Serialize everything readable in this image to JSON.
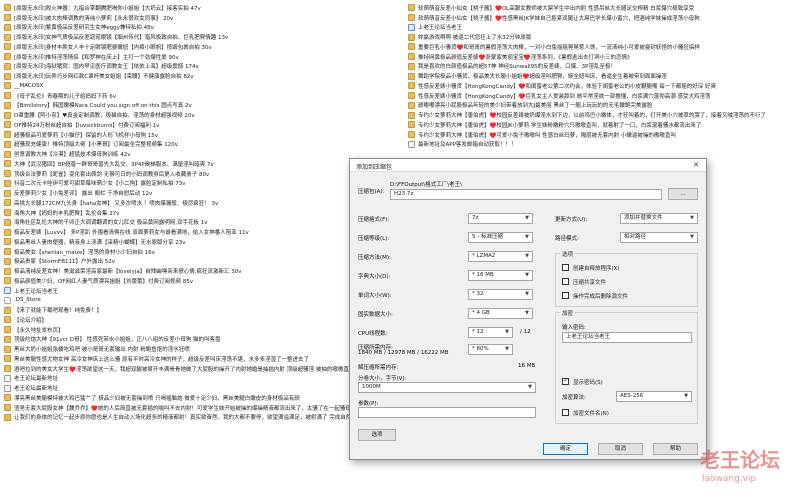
{
  "left_column": [
    {
      "icon": "folder",
      "name": "[原版无水印]败火神器：九指合掌翻腾肥喝你小姐姐【大奶云】接客实拍 47v"
    },
    {
      "icon": "folder",
      "name": "[原版无水印]被大肉棒调教的清纯小萝莉【永永很欢女同事】 20v"
    },
    {
      "icon": "folder",
      "name": "[原版无水印]紫黄极品反差研究生女神eggy兼特私拍 48v"
    },
    {
      "icon": "folder",
      "name": "[原版无水印]女神气质极品反差窈窕眼镜【烟州传代】猎风极致自拍、巨乳肥臀情趣 13v"
    },
    {
      "icon": "folder",
      "name": "[原版无水印]身材丰腴女人丰十足眼镜肥婆嫩妞【内裤小眼帆】揽毁包裹自拍 30v"
    },
    {
      "icon": "folder",
      "name": "[原版无水印]推特淫荡情侣【和罗神在床上】主打一个劲爆性爱 90v"
    },
    {
      "icon": "folder",
      "name": "[原版无水印]海狱猪窝：国内早见医疗调教女王【依依上海】超级震撼 174v"
    },
    {
      "icon": "folder",
      "name": "[原版无水印]玩弄巧步网红款C罩杯美女姐姐【束腰】不健康露脸自拍 82v"
    },
    {
      "icon": "folder",
      "name": "__MACOSX"
    },
    {
      "icon": "folder",
      "name": "《母子乱伦》青春期的儿子给妈妈下药 6v"
    },
    {
      "icon": "folder",
      "name": "【Bimilstory】韩国嫩模Nara Could you sign off on this 圆点写真 2v"
    },
    {
      "icon": "folder",
      "name": "D罩重腰【阿小奈】♥真金定制调教，极猫自拍、淫荡的身材超强视频 20v"
    },
    {
      "icon": "folder",
      "name": "OF推特24万粉丝超自拍【luvsickbunni】付费订阅福利 1v"
    },
    {
      "icon": "folder",
      "name": "超骚极品可爱萝莉【小猫仔】保留的人形飞机杯小母狗 15v"
    },
    {
      "icon": "folder",
      "name": "超骚现充健康！推特顶级大佬【小黑哥】订阅最全完整视频集 120v"
    },
    {
      "icon": "folder",
      "name": "创意调教大神【冷漠】超猛技术爆母狗训练 42v"
    },
    {
      "icon": "folder",
      "name": "大神【武汉猪回】BP超普一群哥哥曾先大乱交、3P4P敞梯服本、满屋淫叫暗爽 7v"
    },
    {
      "icon": "folder",
      "name": "顶级合法萝莉【昵雀】变化套出佩剑 无猴可日的小妈调教身后更入收藏册子 80v"
    },
    {
      "icon": "folder",
      "name": "抖音二次元卡哇伊可爱可甜草莓味萌少女【小二狗】露脸定制私拍 73v"
    },
    {
      "icon": "folder",
      "name": "反差萝莉少女【小兔差评】 露出 阁栏 于净自慰后动 12v"
    },
    {
      "icon": "folder",
      "name": "高挑大长腿172CM九头身【haha女神】 又多次喷水 ！喷肉爆漏般、极尽疯狂！ 3v"
    },
    {
      "icon": "folder",
      "name": "海角大神【妈妈的丰乳肥臀】乱伦合集 27v"
    },
    {
      "icon": "folder",
      "name": "海角社区乱伦大神的千卯正大调调翻调的女儿肛交 极品黄网露明网,双手花板 1v"
    },
    {
      "icon": "folder",
      "name": "极品反差婊【Luvvv】 多P淫趴 外围看清俩在线 双面萝莉女与谁看满地，给入女神番人陪亚 11v"
    },
    {
      "icon": "folder",
      "name": "极品黑丝人妻肉便器，精液身上浇满【采精小蝴蝶】无水原版分享 23v"
    },
    {
      "icon": "folder",
      "name": "极品美女【shenlan_maize】淫荡的身材小少妇自拍 16v"
    },
    {
      "icon": "folder",
      "name": "极品贵家【StormFB111】户外露出 52v"
    },
    {
      "icon": "folder",
      "name": "极品清纯反差女神！美滋滋荣淫高家最新【lovelyja】自残幽嘿亲来撩心情,疯狂流激新汇 30v"
    },
    {
      "icon": "folder",
      "name": "极品颜值美少妇，OF网红人妻气质漂亮姐姐【刘蕾蕾】付费订阅视频 85v"
    },
    {
      "icon": "blue",
      "name": "上老王论坛当老王"
    },
    {
      "icon": "white",
      "name": ".DS_Store"
    },
    {
      "icon": "folder",
      "name": "【来了就能下载吧观看！纯免费！】"
    },
    {
      "icon": "folder",
      "name": "【论坛介绍】"
    },
    {
      "icon": "folder",
      "name": "【永久地址发布页】"
    },
    {
      "icon": "folder",
      "name": "顶级约炮大神【91vcr D哥】 性感死带水小姐姐，正八八组的反差小母狗 猫的叫客盘"
    },
    {
      "icon": "folder",
      "name": "黑丝大奶小姐姐张楼吃鸡吧 被小哥哥无套输出 内射 粉鲍鱼抠的淫水狂喷"
    },
    {
      "icon": "folder",
      "name": "黑丝美腿性感尤物女神 高冷女神床上这么骚 原有平时高冷女神的样子，超级反差叫床淫荡不堪，水多多淫湿了一整进去了"
    },
    {
      "icon": "folder",
      "name": "酒吧拉到的美女大学生♥️淫荡欲望这一天，我超双腿被掰开丰满骨骨她做了大屁股的操开了内射她婚是抽插内射 顶级超骚淫 被抽的嗷嗷直叫还 大眼睛女神淫荡绝出看来欲罢不能的样子"
    },
    {
      "icon": "file",
      "name": "老王论坛最新地址"
    },
    {
      "icon": "file",
      "name": "老王论坛最新地址"
    },
    {
      "icon": "folder",
      "name": "漂亮黑丝美腿模特被大鸡巴猛艹了 极品少妇被无套操到喷 只喝插脑炮 做爱十足少妇，黑丝美腿白嫩皮的身材极品有颜"
    },
    {
      "icon": "folder",
      "name": "渣男无套大屁股女神【魏乔乔】♥️她的人后简直被无套插的喘叫不去内射！可爱学生妹开始被操的爆操精液都流出来了，太骚了在一起骚母狗跟她都狂叫"
    },
    {
      "icon": "folder",
      "name": "让我们的身体的记忆一起步原你愿也是人生自动入场化超多的精液都射！真实欲奋然，我的大都不要停，欲望满溢满足，被射满了 完成自然 "
    }
  ],
  "right_column": [
    {
      "icon": "folder",
      "name": "软萌萌音反差小仙女【桃子酱】♥️OL高跟女教师被大屌学生中出内射 性感吊丝大长腿足交榨精 白浆爆穴极致享受"
    },
    {
      "icon": "folder",
      "name": "软萌萌音反差小仙女【桃子酱】♥️性感黑丝JK学妹自己抠紧双腿让大屌巴学长爆小蜜穴，把酒纯学妹操成淫荡小母狗"
    },
    {
      "icon": "blue",
      "name": "上老王论坛当老王"
    },
    {
      "icon": "folder",
      "name": "妳赢游戏啊啊 被逼二代您狂上了水32分钟原版"
    },
    {
      "icon": "folder",
      "name": "重要巨乳小骚货♥️和哥哥的暑假淫荡大肉棒，一对小白兔摇摇晃晃惹人馋，一流清纯小可爱被曼封妖怪的小骚狂搞样"
    },
    {
      "icon": "folder",
      "name": "推特网黄极品颜值反差婊♥️浙蒙家美丽宝宝♥️淫荡系列，《暑假逃出去打洞小三的恋情》"
    },
    {
      "icon": "folder",
      "name": "我是喜欢的白颜值极品的超57神 神经Sunwall95的反差婊，口爆、3P淫乱至极！"
    },
    {
      "icon": "folder",
      "name": "舞蹈学院极品小骚货，极品美大长腿小姐姐♥️超级淫叫肥臀，婉全妞叫床，看逼全生着被带到面面操淫"
    },
    {
      "icon": "folder",
      "name": "性感反差婊小骚货【HongKongCandy】♥️和闺蜜老公第二次约会，体验下闺蜜老公的小皮鞭腿嘴 每一下都摇的好深 好爽"
    },
    {
      "icon": "folder",
      "name": "性感反差婊小骚货【HongKongCandy】♥️巨乳女主人爱装舔到 她平常淫欲一部撸懂，白浆满穴蓬勃高潮 感受大鸡淫荡"
    },
    {
      "icon": "folder",
      "name": "颜嘟嘟漂亮小屁股极品年轻的美少妇带着放到大J最美丽 黑丝丁一腿上玩玩的的无毛嫩鲍完美露脸"
    },
    {
      "icon": "folder",
      "name": "专约少女萝莉大神【唐伯虎】♥️校园反差婊被奶爆淫水到下边，以前鸡巴小嫩体，才狂叫着的，打开美小穴被草的哭了，接着又喊淫荡的不行了"
    },
    {
      "icon": "folder",
      "name": "专约少女萝莉大神【唐伯虎】♥️校园JK小萝莉 学生妹粉嫩粉穴只嗷嗷直叫，就着射了一口，白浆混着骚水都流出来了"
    },
    {
      "icon": "folder",
      "name": "专约少女萝莉大神【唐伯虎】♥️可爱小兔子嗷嗷叫 性感白丝玛萝，隔层被无套内射 小嫩逼被操的嗷嗷直叫"
    },
    {
      "icon": "file",
      "name": "最新地址及APP客发邮箱自动获取！！！"
    }
  ],
  "dialog": {
    "title": "添加到压缩包",
    "close_glyph": "✕",
    "archive_label": "压缩包(A):",
    "archive_path": "D:\\FFOutput\\格式工厂\\老王\\",
    "archive_name": "H23.7z",
    "browse_label": "...",
    "format_label": "压缩格式(F):",
    "format_value": "7z",
    "level_label": "压缩等级(L):",
    "level_value": "5 - 标准压缩",
    "method_label": "压缩方法(M):",
    "method_value": "* LZMA2",
    "dict_label": "字典大小(D):",
    "dict_value": "* 16 MB",
    "word_label": "单词大小(W):",
    "word_value": "* 32",
    "solid_label": "固实数据大小:",
    "solid_value": "* 4 GB",
    "cpu_label": "CPU线程数:",
    "cpu_value": "* 12",
    "cpu_max": "/ 12",
    "mem_label": "压缩所需内存:",
    "mem_detail": "1840 MB / 12978 MB / 16222 MB",
    "mem_percent": "* 80%",
    "decomp_mem_label": "解压缩所需内存:",
    "decomp_mem_value": "18 MB",
    "split_label": "分卷大小，字节(V):",
    "split_value": "1000M",
    "params_label": "参数(P):",
    "params_value": "",
    "options_button": "选项",
    "update_label": "更新方式(U):",
    "update_value": "添加并替换文件",
    "path_label": "路径模式:",
    "path_value": "相对路径",
    "options_group": "选项",
    "opt_sfx": "创建自释放程序(X)",
    "opt_shared": "压缩共享文件",
    "opt_delete": "操作完成后删除源文件",
    "encrypt_group": "加密",
    "password_label": "输入密码:",
    "password_value": "上老王论坛当老王",
    "show_password_label": "显示密码(S)",
    "encrypt_method_label": "加密算法:",
    "encrypt_method_value": "AES-256",
    "encrypt_names_label": "加密文件名(N)",
    "ok_button": "确定",
    "cancel_button": "取消",
    "help_button": "帮助"
  },
  "watermark": {
    "title": "老王论坛",
    "url": "laowang.vip"
  },
  "colors": {
    "folder": "#e8bd5a",
    "progress": "#06b025",
    "accent": "#0078d7",
    "watermark": "#d63c3c"
  }
}
